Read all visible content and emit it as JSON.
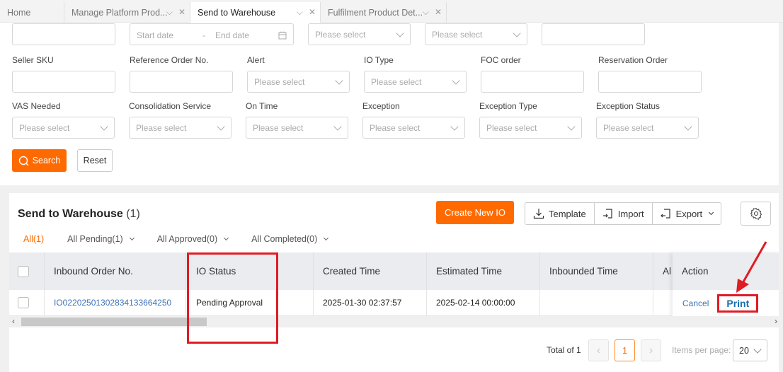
{
  "tabs": [
    {
      "label": "Home",
      "active": false,
      "closable": false
    },
    {
      "label": "Manage Platform Prod...",
      "active": false,
      "closable": true
    },
    {
      "label": "Send to Warehouse",
      "active": true,
      "closable": true
    },
    {
      "label": "Fulfilment Product Det...",
      "active": false,
      "closable": true
    }
  ],
  "filters": {
    "row1": {
      "date_start_placeholder": "Start date",
      "date_separator": "-",
      "date_end_placeholder": "End date",
      "select1_placeholder": "Please select",
      "select2_placeholder": "Please select"
    },
    "seller_sku": {
      "label": "Seller SKU",
      "value": ""
    },
    "reference_order": {
      "label": "Reference Order No.",
      "value": ""
    },
    "alert": {
      "label": "Alert",
      "placeholder": "Please select"
    },
    "io_type": {
      "label": "IO Type",
      "placeholder": "Please select"
    },
    "foc_order": {
      "label": "FOC order",
      "value": ""
    },
    "reservation_order": {
      "label": "Reservation Order",
      "value": ""
    },
    "vas_needed": {
      "label": "VAS Needed",
      "placeholder": "Please select"
    },
    "consolidation_service": {
      "label": "Consolidation Service",
      "placeholder": "Please select"
    },
    "on_time": {
      "label": "On Time",
      "placeholder": "Please select"
    },
    "exception": {
      "label": "Exception",
      "placeholder": "Please select"
    },
    "exception_type": {
      "label": "Exception Type",
      "placeholder": "Please select"
    },
    "exception_status": {
      "label": "Exception Status",
      "placeholder": "Please select"
    },
    "search_label": "Search",
    "reset_label": "Reset"
  },
  "panel": {
    "title": "Send to Warehouse",
    "count": "(1)",
    "create_label": "Create New IO",
    "template_label": "Template",
    "import_label": "Import",
    "export_label": "Export",
    "subtabs": [
      {
        "label": "All(1)",
        "active": true
      },
      {
        "label": "All Pending(1)",
        "dropdown": true
      },
      {
        "label": "All Approved(0)",
        "dropdown": true
      },
      {
        "label": "All Completed(0)",
        "dropdown": true
      }
    ]
  },
  "table": {
    "columns": [
      "Inbound Order No.",
      "IO Status",
      "Created Time",
      "Estimated Time",
      "Inbounded Time",
      "Al",
      "Action"
    ],
    "rows": [
      {
        "inbound_order_no": "IO02202501302834133664250",
        "io_status": "Pending Approval",
        "created_time": "2025-01-30 02:37:57",
        "estimated_time": "2025-02-14 00:00:00",
        "inbounded_time": "",
        "actions": {
          "cancel": "Cancel",
          "print": "Print"
        }
      }
    ]
  },
  "pagination": {
    "total_label": "Total of 1",
    "current_page": "1",
    "items_per_page_label": "Items per page:",
    "page_size": "20"
  },
  "annotations": {
    "highlight_color": "#e01b24"
  },
  "colors": {
    "accent": "#ff6a00",
    "link": "#3f72b5"
  }
}
